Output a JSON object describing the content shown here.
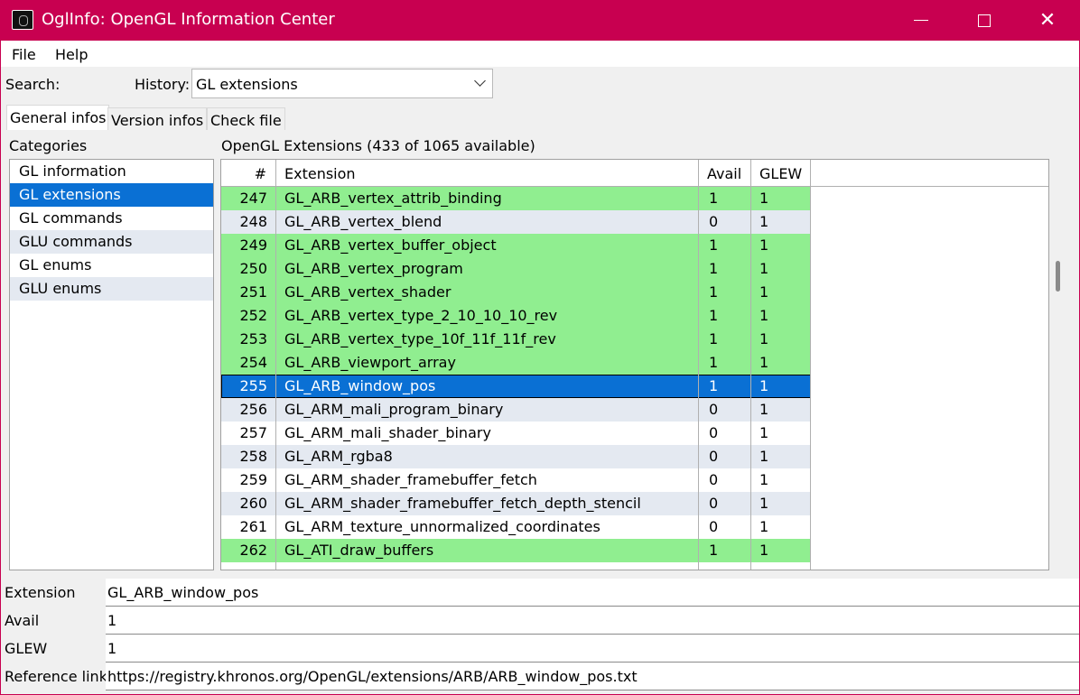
{
  "window": {
    "title": "OglInfo: OpenGL Information Center",
    "accent_color": "#c80050",
    "controls": {
      "minimize": "minimize-icon",
      "maximize": "maximize-icon",
      "close": "✕"
    }
  },
  "menu": {
    "file": "File",
    "help": "Help"
  },
  "search": {
    "label": "Search:"
  },
  "history": {
    "label": "History:",
    "value": "GL extensions"
  },
  "tabs": [
    "General infos",
    "Version infos",
    "Check file"
  ],
  "categories": {
    "label": "Categories",
    "items": [
      "GL information",
      "GL extensions",
      "GL commands",
      "GLU commands",
      "GL enums",
      "GLU enums"
    ]
  },
  "extensions": {
    "label": "OpenGL Extensions (433 of 1065 available)",
    "headers": {
      "num": "#",
      "extension": "Extension",
      "avail": "Avail",
      "glew": "GLEW"
    },
    "colors": {
      "available": "#90ee90",
      "selected": "#0a70d4",
      "alternate": "#e4e9f1"
    },
    "rows": [
      {
        "num": "247",
        "name": "GL_ARB_vertex_attrib_binding",
        "avail": "1",
        "glew": "1",
        "state": "green"
      },
      {
        "num": "248",
        "name": "GL_ARB_vertex_blend",
        "avail": "0",
        "glew": "1",
        "state": "blue"
      },
      {
        "num": "249",
        "name": "GL_ARB_vertex_buffer_object",
        "avail": "1",
        "glew": "1",
        "state": "green"
      },
      {
        "num": "250",
        "name": "GL_ARB_vertex_program",
        "avail": "1",
        "glew": "1",
        "state": "green"
      },
      {
        "num": "251",
        "name": "GL_ARB_vertex_shader",
        "avail": "1",
        "glew": "1",
        "state": "green"
      },
      {
        "num": "252",
        "name": "GL_ARB_vertex_type_2_10_10_10_rev",
        "avail": "1",
        "glew": "1",
        "state": "green"
      },
      {
        "num": "253",
        "name": "GL_ARB_vertex_type_10f_11f_11f_rev",
        "avail": "1",
        "glew": "1",
        "state": "green"
      },
      {
        "num": "254",
        "name": "GL_ARB_viewport_array",
        "avail": "1",
        "glew": "1",
        "state": "green"
      },
      {
        "num": "255",
        "name": "GL_ARB_window_pos",
        "avail": "1",
        "glew": "1",
        "state": "sel"
      },
      {
        "num": "256",
        "name": "GL_ARM_mali_program_binary",
        "avail": "0",
        "glew": "1",
        "state": "blue"
      },
      {
        "num": "257",
        "name": "GL_ARM_mali_shader_binary",
        "avail": "0",
        "glew": "1",
        "state": "white"
      },
      {
        "num": "258",
        "name": "GL_ARM_rgba8",
        "avail": "0",
        "glew": "1",
        "state": "blue"
      },
      {
        "num": "259",
        "name": "GL_ARM_shader_framebuffer_fetch",
        "avail": "0",
        "glew": "1",
        "state": "white"
      },
      {
        "num": "260",
        "name": "GL_ARM_shader_framebuffer_fetch_depth_stencil",
        "avail": "0",
        "glew": "1",
        "state": "blue"
      },
      {
        "num": "261",
        "name": "GL_ARM_texture_unnormalized_coordinates",
        "avail": "0",
        "glew": "1",
        "state": "white"
      },
      {
        "num": "262",
        "name": "GL_ATI_draw_buffers",
        "avail": "1",
        "glew": "1",
        "state": "green"
      }
    ]
  },
  "details": {
    "extension_label": "Extension",
    "extension_value": "GL_ARB_window_pos",
    "avail_label": "Avail",
    "avail_value": "1",
    "glew_label": "GLEW",
    "glew_value": "1",
    "link_label": "Reference link",
    "link_value": "https://registry.khronos.org/OpenGL/extensions/ARB/ARB_window_pos.txt"
  }
}
